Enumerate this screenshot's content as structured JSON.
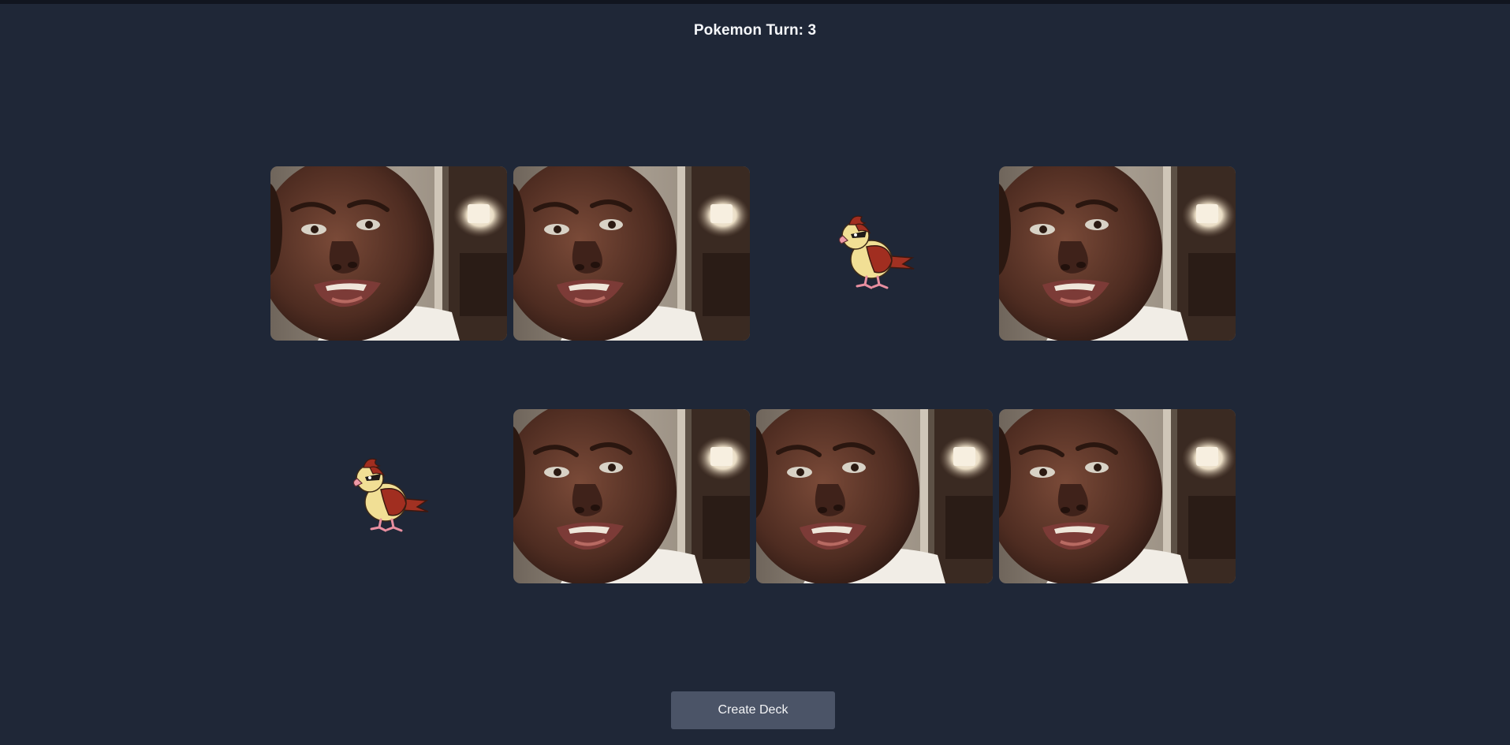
{
  "header": {
    "turn_label": "Pokemon Turn: 3"
  },
  "board": {
    "cards": [
      {
        "state": "face-down",
        "image": "crying-face-photo"
      },
      {
        "state": "face-down",
        "image": "crying-face-photo"
      },
      {
        "state": "face-up",
        "image": "pidgey-bird-sprite"
      },
      {
        "state": "face-down",
        "image": "crying-face-photo"
      },
      {
        "state": "face-up",
        "image": "pidgey-bird-sprite"
      },
      {
        "state": "face-down",
        "image": "crying-face-photo"
      },
      {
        "state": "face-down",
        "image": "crying-face-photo"
      },
      {
        "state": "face-down",
        "image": "crying-face-photo"
      }
    ]
  },
  "controls": {
    "create_deck_label": "Create Deck"
  },
  "colors": {
    "background": "#1f2737",
    "button": "#4b5467",
    "text": "#f3f4f6"
  }
}
